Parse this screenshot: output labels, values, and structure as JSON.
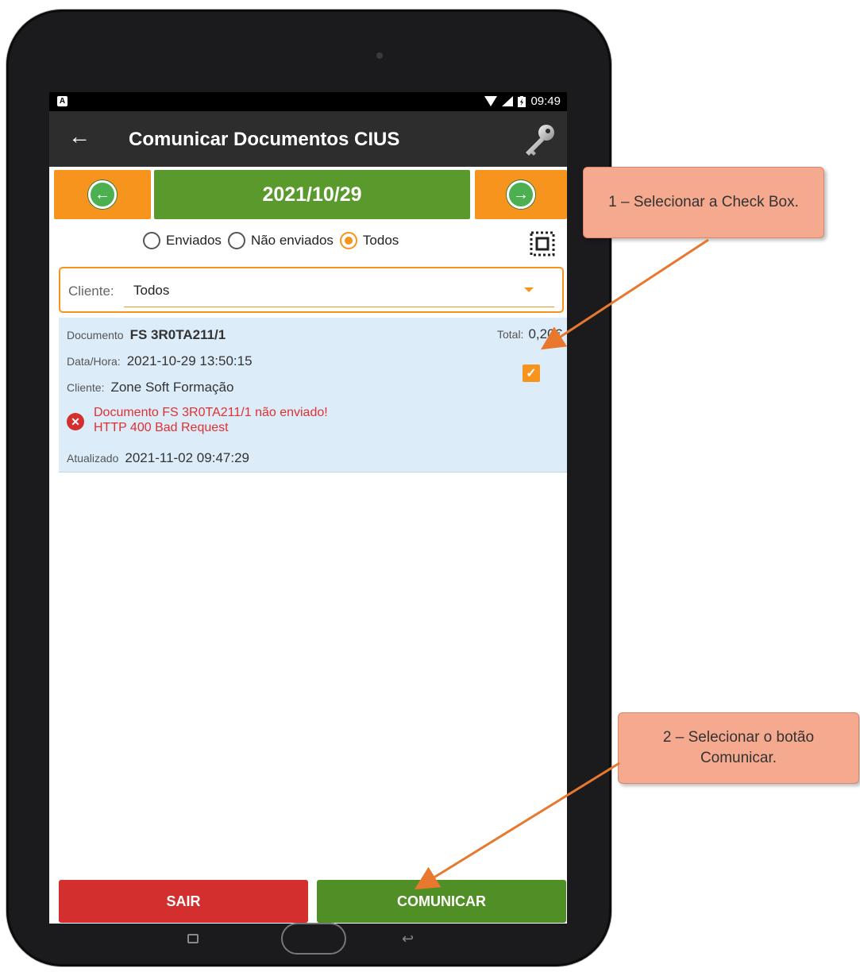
{
  "status_bar": {
    "time": "09:49",
    "indicator": "A"
  },
  "app_bar": {
    "title": "Comunicar Documentos CIUS",
    "back_icon": "arrow-left-icon",
    "key_icon": "key-icon"
  },
  "date_nav": {
    "date": "2021/10/29"
  },
  "filters": {
    "options": [
      {
        "label": "Enviados",
        "selected": false
      },
      {
        "label": "Não enviados",
        "selected": false
      },
      {
        "label": "Todos",
        "selected": true
      }
    ]
  },
  "client_filter": {
    "label": "Cliente:",
    "value": "Todos"
  },
  "document": {
    "doc_label": "Documento",
    "doc_number": "FS 3R0TA211/1",
    "total_label": "Total:",
    "total_value": "0,20€",
    "date_label": "Data/Hora:",
    "date_value": "2021-10-29 13:50:15",
    "client_label": "Cliente:",
    "client_value": "Zone Soft Formação",
    "error_line1": "Documento FS 3R0TA211/1 não enviado!",
    "error_line2": "HTTP 400 Bad Request",
    "updated_label": "Atualizado",
    "updated_value": "2021-11-02 09:47:29",
    "checked": true
  },
  "buttons": {
    "exit": "SAIR",
    "communicate": "COMUNICAR"
  },
  "callouts": {
    "step1": "1 – Selecionar a Check Box.",
    "step2": "2 – Selecionar o botão Comunicar."
  },
  "colors": {
    "orange": "#f7941d",
    "green": "#5a9a2d",
    "red": "#d32f2f",
    "callout": "#f5a98e",
    "arrow": "#e8782e"
  }
}
